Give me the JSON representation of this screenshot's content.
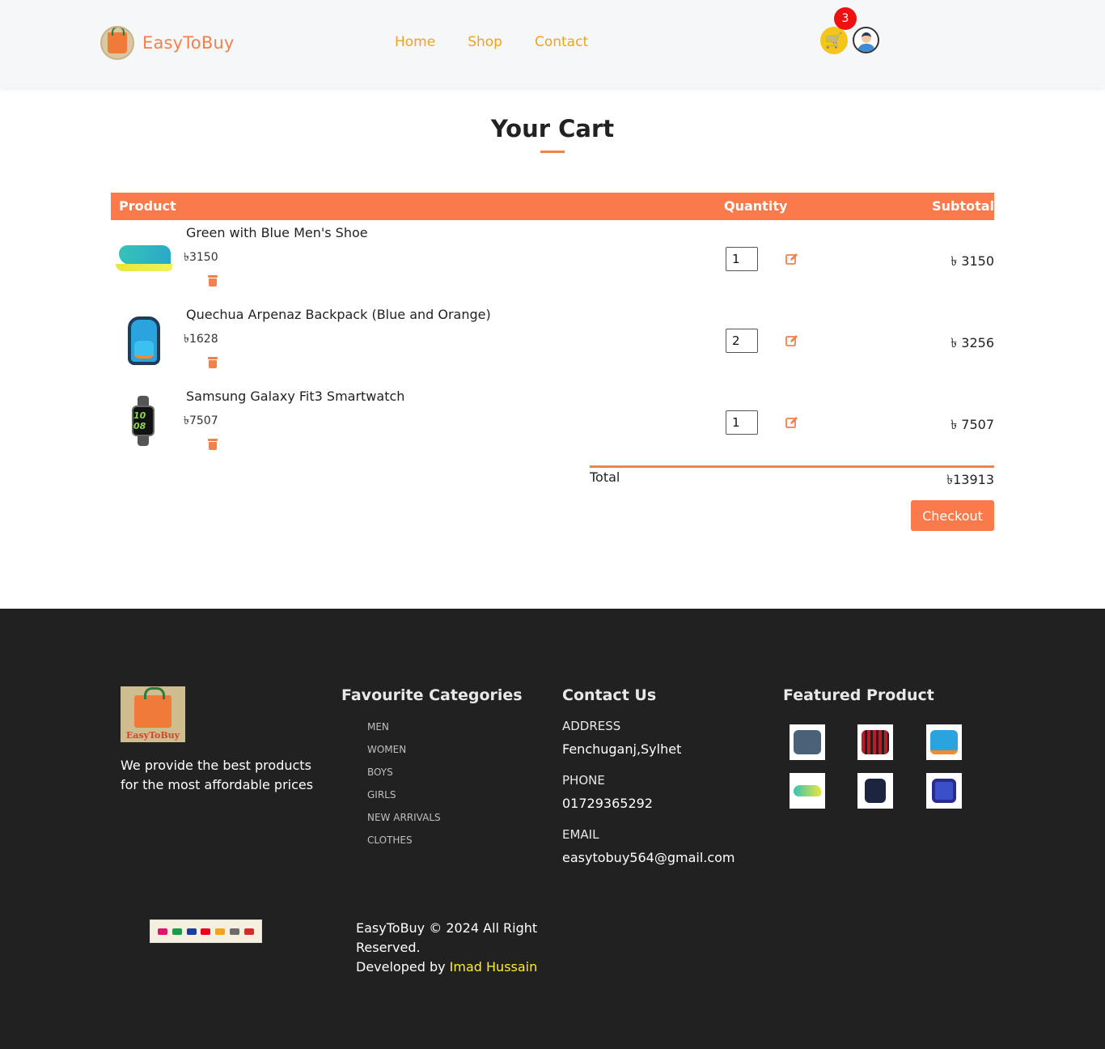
{
  "header": {
    "brand_name": "EasyToBuy",
    "nav": [
      "Home",
      "Shop",
      "Contact"
    ],
    "cart_count": "3"
  },
  "cart": {
    "title": "Your Cart",
    "columns": {
      "product": "Product",
      "quantity": "Quantity",
      "subtotal": "Subtotal"
    },
    "items": [
      {
        "name": "Green with Blue Men's Shoe",
        "price": "৳3150",
        "quantity": "1",
        "subtotal": "৳ 3150",
        "icon": "shoe-image"
      },
      {
        "name": "Quechua Arpenaz Backpack (Blue and Orange)",
        "price": "৳1628",
        "quantity": "2",
        "subtotal": "৳ 3256",
        "icon": "backpack-image"
      },
      {
        "name": "Samsung Galaxy Fit3 Smartwatch",
        "price": "৳7507",
        "quantity": "1",
        "subtotal": "৳ 7507",
        "icon": "smartwatch-image"
      }
    ],
    "watch_face_text": "10 08",
    "total_label": "Total",
    "total_value": "৳13913",
    "checkout_label": "Checkout"
  },
  "footer": {
    "logo_text": "EasyToBuy",
    "tagline": "We provide the best products for the most affordable prices",
    "categories_title": "Favourite Categories",
    "categories": [
      "MEN",
      "WOMEN",
      "BOYS",
      "GIRLS",
      "NEW ARRIVALS",
      "CLOTHES"
    ],
    "contact_title": "Contact Us",
    "address_label": "ADDRESS",
    "address": "Fenchuganj,Sylhet",
    "phone_label": "PHONE",
    "phone": "01729365292",
    "email_label": "EMAIL",
    "email": "easytobuy564@gmail.com",
    "featured_title": "Featured Product",
    "featured_products": [
      "handbag",
      "checked-shirt",
      "backpack",
      "shoe",
      "jacket",
      "smartwatch"
    ],
    "copyright": "EasyToBuy © 2024 All Right Reserved.",
    "developed_by": "Developed by",
    "developer": "Imad Hussain"
  },
  "colors": {
    "accent": "#fb7a4b",
    "nav": "#f4a21b",
    "footer_bg": "#212121",
    "developer_highlight": "#ffef1f",
    "badge": "#ee1111"
  }
}
